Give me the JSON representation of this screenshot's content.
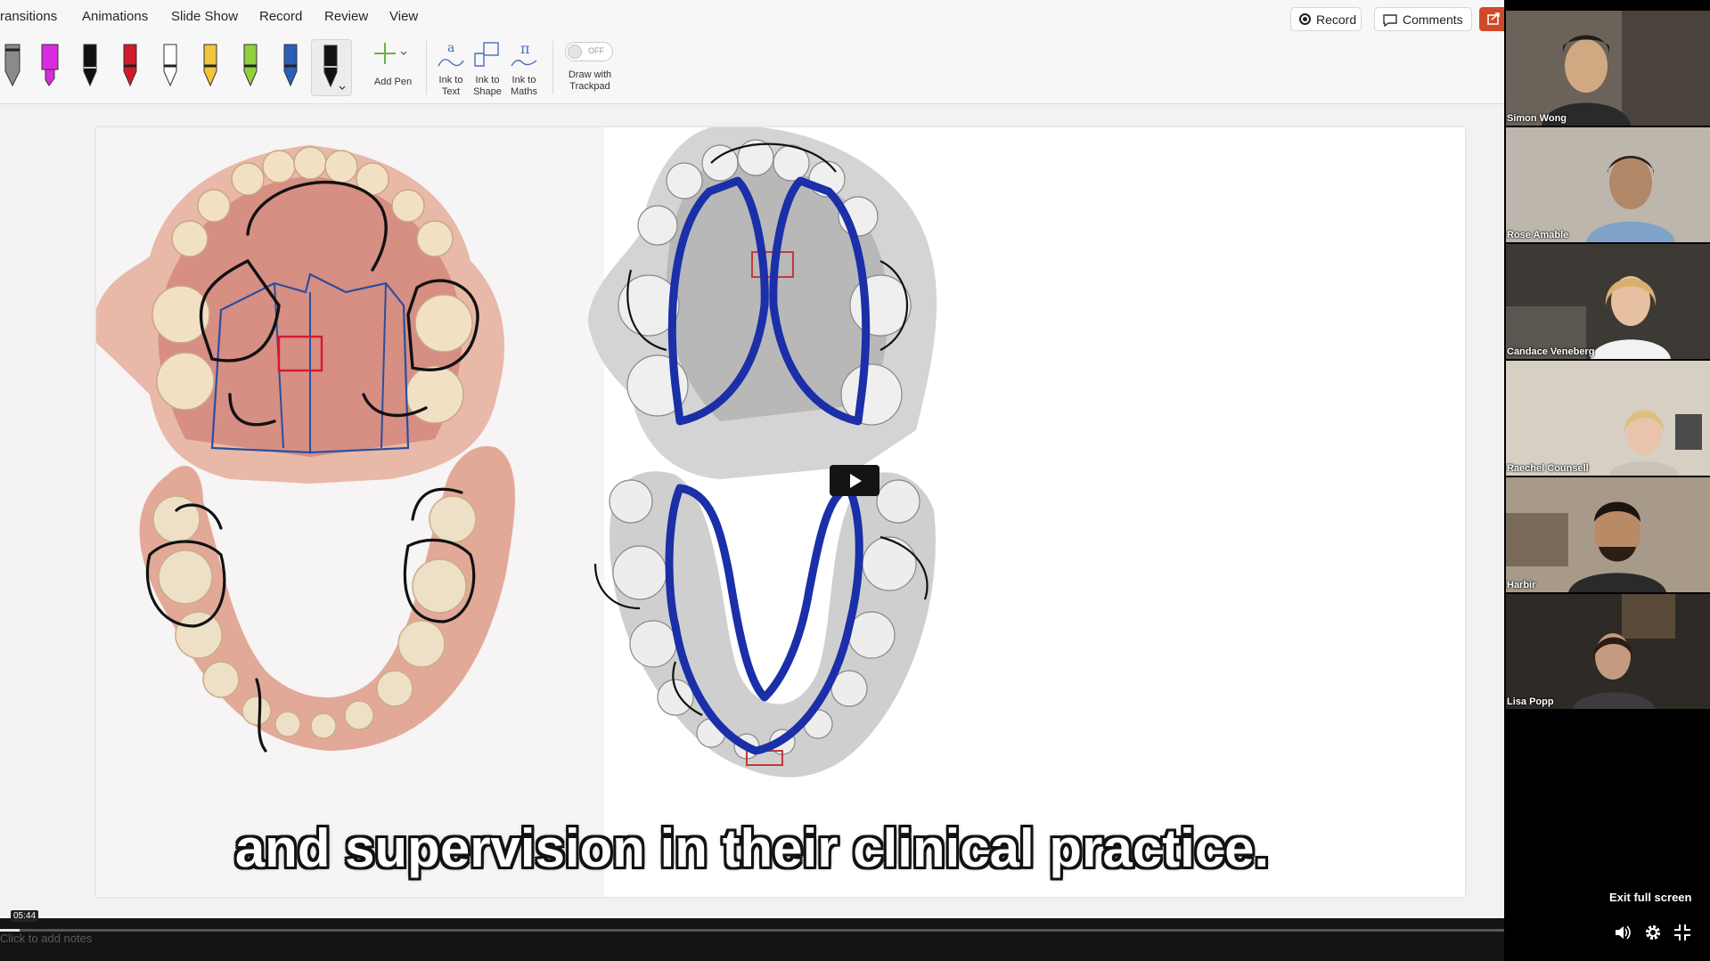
{
  "ribbon": {
    "tabs": [
      "ransitions",
      "Animations",
      "Slide Show",
      "Record",
      "Review",
      "View"
    ],
    "record_label": "Record",
    "comments_label": "Comments",
    "pens": [
      {
        "icon": "pencil-gray-icon",
        "color": "#7a7a7a"
      },
      {
        "icon": "highlighter-magenta-icon",
        "color": "#d92be0"
      },
      {
        "icon": "pen-black-icon",
        "color": "#111111"
      },
      {
        "icon": "pen-red-icon",
        "color": "#d41a2a"
      },
      {
        "icon": "pen-white-icon",
        "color": "#ffffff"
      },
      {
        "icon": "pen-yellow-icon",
        "color": "#f0c53a"
      },
      {
        "icon": "pen-green-icon",
        "color": "#8fd13a"
      },
      {
        "icon": "pen-blue-icon",
        "color": "#2a5fb8"
      },
      {
        "icon": "pen-black-selected-icon",
        "color": "#111111"
      }
    ],
    "add_pen_label": "Add Pen",
    "ink_to_text_label": [
      "Ink to",
      "Text"
    ],
    "ink_to_shape_label": [
      "Ink to",
      "Shape"
    ],
    "ink_to_maths_label": [
      "Ink to",
      "Maths"
    ],
    "toggle_state": "OFF",
    "draw_trackpad_label": [
      "Draw with",
      "Trackpad"
    ]
  },
  "caption": "and supervision in their clinical practice.",
  "player": {
    "time": "05:44",
    "notes_placeholder": "Click to add notes",
    "exit_fullscreen": "Exit full screen",
    "progress_fraction": 0.012
  },
  "participants": [
    {
      "name": "Simon Wong"
    },
    {
      "name": "Rose Amable"
    },
    {
      "name": "Candace Veneberg"
    },
    {
      "name": "Raechel Counsell"
    },
    {
      "name": "Harbir"
    },
    {
      "name": "Lisa Popp"
    }
  ],
  "colors": {
    "ink_black": "#111111",
    "ink_blue": "#1a2fa8",
    "ink_red": "#d41a2a",
    "share_accent": "#d04a2a"
  }
}
